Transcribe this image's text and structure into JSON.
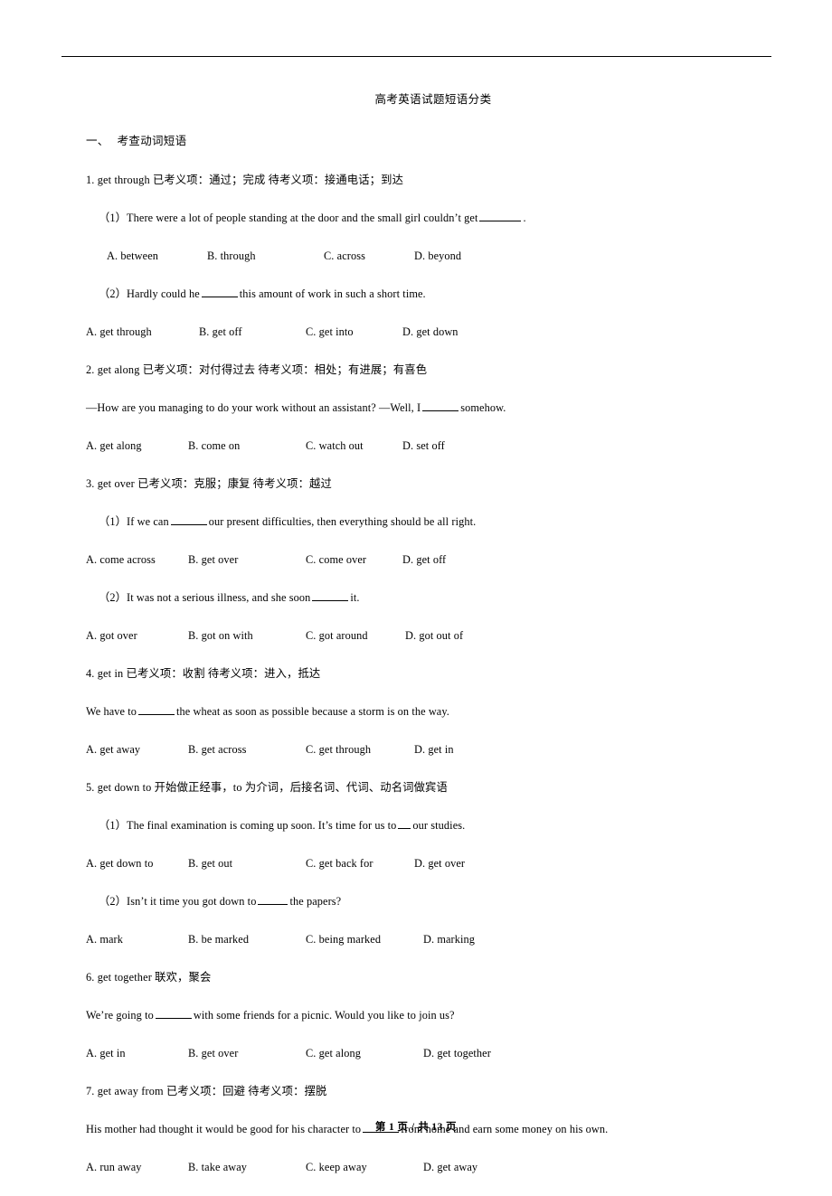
{
  "document": {
    "title": "高考英语试题短语分类",
    "section_heading": {
      "number": "一、",
      "label": "考查动词短语"
    }
  },
  "entries": [
    {
      "id": "get-through",
      "heading": "1. get through  已考义项：通过；完成 待考义项：接通电话；到达",
      "questions": [
        {
          "label": "（1）",
          "stem_before": "There were a lot of people standing at the door and the small girl couldn’t get",
          "stem_after": ".",
          "options": [
            "A. between",
            "B. through",
            "C. across",
            "D. beyond"
          ]
        },
        {
          "label": "（2）",
          "stem_before": "Hardly could he",
          "stem_after": "this amount of work in such a short time.",
          "options": [
            "A. get through",
            "B. get off",
            "C. get into",
            "D. get down"
          ]
        }
      ]
    },
    {
      "id": "get-along",
      "heading": "2. get along 已考义项：对付得过去   待考义项：相处；有进展；有喜色",
      "questions": [
        {
          "label": "",
          "stem_before": "—How are you managing to do your work without an assistant?   —Well, I",
          "stem_after": "somehow.",
          "options": [
            "A. get along",
            "B. come on",
            "C. watch out",
            "D. set off"
          ]
        }
      ]
    },
    {
      "id": "get-over",
      "heading": "3. get over  已考义项：克服；康复 待考义项：越过",
      "questions": [
        {
          "label": "（1）",
          "stem_before": "If we can",
          "stem_after": "our present difficulties, then everything should be all right.",
          "options": [
            "A. come across",
            "B. get over",
            "C. come over",
            "D. get off"
          ]
        },
        {
          "label": "（2）",
          "stem_before": "It was not a serious illness, and she soon",
          "stem_after": "it.",
          "options": [
            "A. got over",
            "B. got on with",
            "C. got around",
            "D. got out of"
          ]
        }
      ]
    },
    {
      "id": "get-in",
      "heading": "4. get in 已考义项：收割 待考义项：进入，抵达",
      "questions": [
        {
          "label": "",
          "stem_before": "We have to",
          "stem_after": "the wheat as soon as possible because a storm is on the way.",
          "options": [
            "A. get away",
            "B. get across",
            "C. get through",
            "D. get in"
          ]
        }
      ]
    },
    {
      "id": "get-down-to",
      "heading": "5. get down to 开始做正经事，to 为介词，后接名词、代词、动名词做宾语",
      "questions": [
        {
          "label": "（1）",
          "stem_before": "The final examination is coming up soon. It’s time for us to",
          "stem_after": "our studies.",
          "options": [
            "A. get down to",
            "B. get out",
            "C. get back for",
            "D. get over"
          ]
        },
        {
          "label": "（2）",
          "stem_before": "Isn’t it time you got down to",
          "stem_after": "the papers?",
          "options": [
            "A. mark",
            "B. be marked",
            "C. being marked",
            "D. marking"
          ]
        }
      ]
    },
    {
      "id": "get-together",
      "heading": "6. get together 联欢，聚会",
      "questions": [
        {
          "label": "",
          "stem_before": "We’re going to",
          "stem_after": "with some friends for a picnic. Would you like to join us?",
          "options": [
            "A. get in",
            "B. get over",
            "C. get along",
            "D. get together"
          ]
        }
      ]
    },
    {
      "id": "get-away-from",
      "heading": "7. get away from  已考义项：回避 待考义项：摆脱",
      "questions": [
        {
          "label": "",
          "stem_before": "His mother had thought it would be good for his character to",
          "stem_after": "from home and earn some money on his own.",
          "options": [
            "A. run away",
            "B. take away",
            "C. keep away",
            "D. get away"
          ]
        }
      ]
    }
  ],
  "footer": {
    "prefix": "第",
    "page": "1",
    "separator": "页 /  共",
    "total": "13",
    "suffix": "页"
  }
}
